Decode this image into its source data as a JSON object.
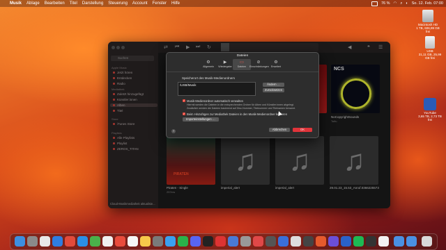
{
  "menubar": {
    "items": [
      "Musik",
      "Ablage",
      "Bearbeiten",
      "Titel",
      "Darstellung",
      "Steuerung",
      "Account",
      "Fenster",
      "Hilfe"
    ],
    "battery": "76 %",
    "datetime": "So. 12. Feb. 07:00"
  },
  "desktop": {
    "icons": [
      {
        "name": "Macintosh HD",
        "sub": "1 TB, 606,99 GB frei"
      },
      {
        "name": "USB",
        "sub": "31,11 GB, 25,99 GB frei"
      },
      {
        "name": "YouTube",
        "sub": "3,65 TB, 2,73 TB frei"
      }
    ]
  },
  "sidebar": {
    "search_placeholder": "Suchen",
    "sections": [
      {
        "title": "Apple Music",
        "items": [
          "Jetzt hören",
          "Entdecken",
          "Radio"
        ]
      },
      {
        "title": "Mediathek",
        "items": [
          "Zuletzt hinzugefügt",
          "Künstler:innen",
          "Alben",
          "Titel"
        ]
      },
      {
        "title": "Store",
        "items": [
          "iTunes Store"
        ]
      },
      {
        "title": "Playlists",
        "items": [
          "Alle Playlists",
          "Playlist",
          "ZEROS_TITAN"
        ]
      }
    ],
    "selected": "Alben",
    "status": "Cloud-Musikmediathek aktualisie..."
  },
  "albums": [
    {
      "title": "NoCopyrightSounds",
      "artist": "Tolfu"
    },
    {
      "title": "Piraten - Single",
      "artist": "257ers"
    },
    {
      "title": "imperial_alert",
      "artist": ""
    },
    {
      "title": "imperial_alert",
      "artist": ""
    },
    {
      "title": "29.01.23_15.53_Anruf.0366225573",
      "artist": ""
    }
  ],
  "dialog": {
    "title": "Dateien",
    "tabs": [
      {
        "label": "Allgemein",
        "icon": "⚙"
      },
      {
        "label": "Wiedergabe",
        "icon": "▶"
      },
      {
        "label": "Dateien",
        "icon": "▭"
      },
      {
        "label": "Einschränkungen",
        "icon": "⊘"
      },
      {
        "label": "Erweitert",
        "icon": "⚙"
      }
    ],
    "location_label": "Speicherort des Musik-Medienordners",
    "location_path": "/USB/Musik",
    "change_button": "Ändern …",
    "reset_button": "Zurücksetzen",
    "organize_label": "Musik-Medienordner automatisch verwalten",
    "organize_desc_1": "Hiermit werden die Dateien in die entsprechenden Ordner für Alben und Künstler:innen abgelegt.",
    "organize_desc_2": "Zusätzlich werden die Dateien basierend auf Disc-Nummer, Titelnummer und Titelnamen benannt.",
    "copy_label": "Beim Hinzufügen zur Mediathek Dateien in den Musik-Medienordner kopieren",
    "import_button": "Importeinstellungen …",
    "help": "?",
    "cancel_button": "Abbrechen",
    "ok_button": "OK"
  }
}
